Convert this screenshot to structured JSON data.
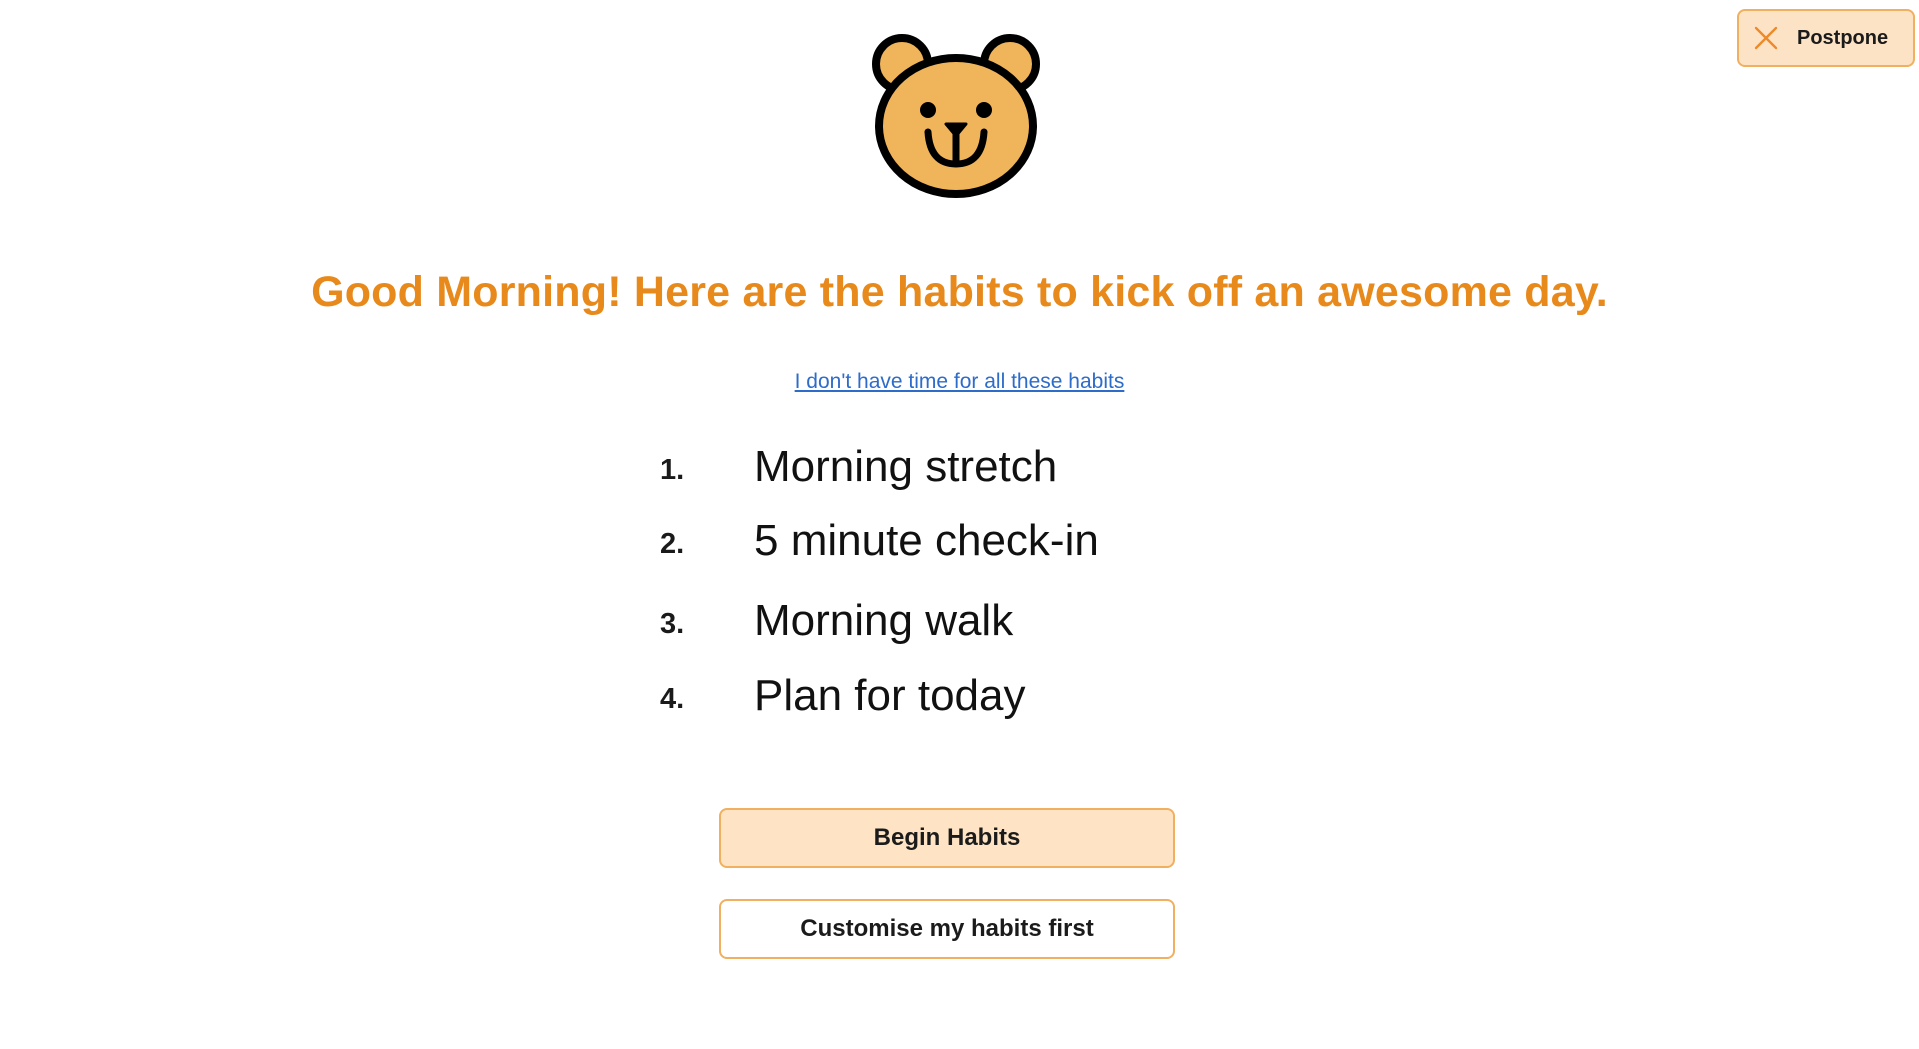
{
  "header": {
    "postpone_label": "Postpone",
    "postpone_icon": "close-icon"
  },
  "logo": {
    "icon": "bear-face-icon",
    "colors": {
      "face": "#f0b45a",
      "outline": "#000000"
    }
  },
  "main": {
    "heading": "Good Morning! Here are the habits to kick off an awesome day.",
    "no_time_link": "I don't have time for all these habits",
    "habits": [
      {
        "number": "1.",
        "label": "Morning stretch"
      },
      {
        "number": "2.",
        "label": "5 minute check-in"
      },
      {
        "number": "3.",
        "label": "Morning walk"
      },
      {
        "number": "4.",
        "label": "Plan for today"
      }
    ],
    "begin_button": "Begin Habits",
    "customise_button": "Customise my habits first"
  },
  "colors": {
    "accent": "#e8891b",
    "button_border": "#f0b060",
    "button_fill": "#fee4c5",
    "link": "#2e6cc9"
  }
}
